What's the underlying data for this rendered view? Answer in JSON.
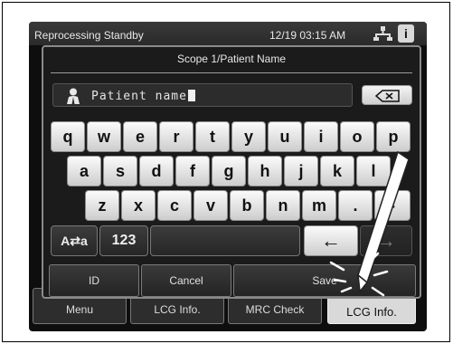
{
  "status_bar": {
    "title": "Reprocessing Standby",
    "datetime": "12/19 03:15 AM",
    "network_icon": "network-icon",
    "info_icon": "i"
  },
  "background_buttons": {
    "menu": "Menu",
    "lcg_info_1": "LCG Info.",
    "mrc_check": "MRC Check",
    "lcg_info_2": "LCG Info."
  },
  "dialog": {
    "title": "Scope 1/Patient Name",
    "input_value": "Patient name",
    "input_icon": "person-icon",
    "backspace_icon": "backspace-icon"
  },
  "keyboard": {
    "row1": [
      "q",
      "w",
      "e",
      "r",
      "t",
      "y",
      "u",
      "i",
      "o",
      "p"
    ],
    "row2": [
      "a",
      "s",
      "d",
      "f",
      "g",
      "h",
      "j",
      "k",
      "l"
    ],
    "row3": [
      "z",
      "x",
      "c",
      "v",
      "b",
      "n",
      "m",
      ".",
      "-"
    ],
    "toggle": "A⇄a",
    "numbers": "123",
    "left_arrow": "←",
    "right_arrow": "→"
  },
  "actions": {
    "id": "ID",
    "cancel": "Cancel",
    "save": "Save"
  }
}
